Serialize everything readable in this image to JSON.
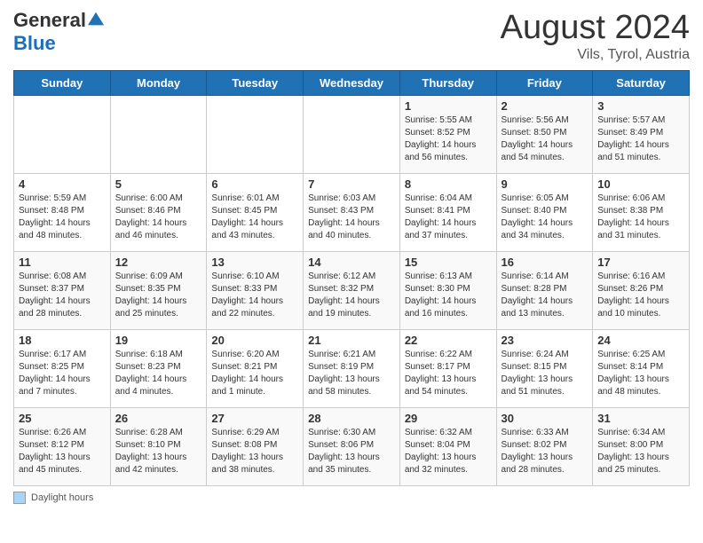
{
  "header": {
    "logo_general": "General",
    "logo_blue": "Blue",
    "month_title": "August 2024",
    "subtitle": "Vils, Tyrol, Austria"
  },
  "weekdays": [
    "Sunday",
    "Monday",
    "Tuesday",
    "Wednesday",
    "Thursday",
    "Friday",
    "Saturday"
  ],
  "weeks": [
    [
      {
        "day": "",
        "info": ""
      },
      {
        "day": "",
        "info": ""
      },
      {
        "day": "",
        "info": ""
      },
      {
        "day": "",
        "info": ""
      },
      {
        "day": "1",
        "info": "Sunrise: 5:55 AM\nSunset: 8:52 PM\nDaylight: 14 hours and 56 minutes."
      },
      {
        "day": "2",
        "info": "Sunrise: 5:56 AM\nSunset: 8:50 PM\nDaylight: 14 hours and 54 minutes."
      },
      {
        "day": "3",
        "info": "Sunrise: 5:57 AM\nSunset: 8:49 PM\nDaylight: 14 hours and 51 minutes."
      }
    ],
    [
      {
        "day": "4",
        "info": "Sunrise: 5:59 AM\nSunset: 8:48 PM\nDaylight: 14 hours and 48 minutes."
      },
      {
        "day": "5",
        "info": "Sunrise: 6:00 AM\nSunset: 8:46 PM\nDaylight: 14 hours and 46 minutes."
      },
      {
        "day": "6",
        "info": "Sunrise: 6:01 AM\nSunset: 8:45 PM\nDaylight: 14 hours and 43 minutes."
      },
      {
        "day": "7",
        "info": "Sunrise: 6:03 AM\nSunset: 8:43 PM\nDaylight: 14 hours and 40 minutes."
      },
      {
        "day": "8",
        "info": "Sunrise: 6:04 AM\nSunset: 8:41 PM\nDaylight: 14 hours and 37 minutes."
      },
      {
        "day": "9",
        "info": "Sunrise: 6:05 AM\nSunset: 8:40 PM\nDaylight: 14 hours and 34 minutes."
      },
      {
        "day": "10",
        "info": "Sunrise: 6:06 AM\nSunset: 8:38 PM\nDaylight: 14 hours and 31 minutes."
      }
    ],
    [
      {
        "day": "11",
        "info": "Sunrise: 6:08 AM\nSunset: 8:37 PM\nDaylight: 14 hours and 28 minutes."
      },
      {
        "day": "12",
        "info": "Sunrise: 6:09 AM\nSunset: 8:35 PM\nDaylight: 14 hours and 25 minutes."
      },
      {
        "day": "13",
        "info": "Sunrise: 6:10 AM\nSunset: 8:33 PM\nDaylight: 14 hours and 22 minutes."
      },
      {
        "day": "14",
        "info": "Sunrise: 6:12 AM\nSunset: 8:32 PM\nDaylight: 14 hours and 19 minutes."
      },
      {
        "day": "15",
        "info": "Sunrise: 6:13 AM\nSunset: 8:30 PM\nDaylight: 14 hours and 16 minutes."
      },
      {
        "day": "16",
        "info": "Sunrise: 6:14 AM\nSunset: 8:28 PM\nDaylight: 14 hours and 13 minutes."
      },
      {
        "day": "17",
        "info": "Sunrise: 6:16 AM\nSunset: 8:26 PM\nDaylight: 14 hours and 10 minutes."
      }
    ],
    [
      {
        "day": "18",
        "info": "Sunrise: 6:17 AM\nSunset: 8:25 PM\nDaylight: 14 hours and 7 minutes."
      },
      {
        "day": "19",
        "info": "Sunrise: 6:18 AM\nSunset: 8:23 PM\nDaylight: 14 hours and 4 minutes."
      },
      {
        "day": "20",
        "info": "Sunrise: 6:20 AM\nSunset: 8:21 PM\nDaylight: 14 hours and 1 minute."
      },
      {
        "day": "21",
        "info": "Sunrise: 6:21 AM\nSunset: 8:19 PM\nDaylight: 13 hours and 58 minutes."
      },
      {
        "day": "22",
        "info": "Sunrise: 6:22 AM\nSunset: 8:17 PM\nDaylight: 13 hours and 54 minutes."
      },
      {
        "day": "23",
        "info": "Sunrise: 6:24 AM\nSunset: 8:15 PM\nDaylight: 13 hours and 51 minutes."
      },
      {
        "day": "24",
        "info": "Sunrise: 6:25 AM\nSunset: 8:14 PM\nDaylight: 13 hours and 48 minutes."
      }
    ],
    [
      {
        "day": "25",
        "info": "Sunrise: 6:26 AM\nSunset: 8:12 PM\nDaylight: 13 hours and 45 minutes."
      },
      {
        "day": "26",
        "info": "Sunrise: 6:28 AM\nSunset: 8:10 PM\nDaylight: 13 hours and 42 minutes."
      },
      {
        "day": "27",
        "info": "Sunrise: 6:29 AM\nSunset: 8:08 PM\nDaylight: 13 hours and 38 minutes."
      },
      {
        "day": "28",
        "info": "Sunrise: 6:30 AM\nSunset: 8:06 PM\nDaylight: 13 hours and 35 minutes."
      },
      {
        "day": "29",
        "info": "Sunrise: 6:32 AM\nSunset: 8:04 PM\nDaylight: 13 hours and 32 minutes."
      },
      {
        "day": "30",
        "info": "Sunrise: 6:33 AM\nSunset: 8:02 PM\nDaylight: 13 hours and 28 minutes."
      },
      {
        "day": "31",
        "info": "Sunrise: 6:34 AM\nSunset: 8:00 PM\nDaylight: 13 hours and 25 minutes."
      }
    ]
  ],
  "footer": {
    "box_label": "Daylight hours"
  }
}
